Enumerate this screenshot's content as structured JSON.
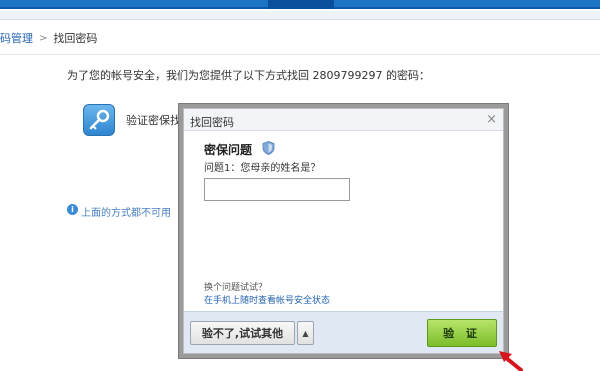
{
  "breadcrumb": {
    "parent": "码管理",
    "separator": ">",
    "current": "找回密码"
  },
  "intro_text": "为了您的帐号安全，我们为您提供了以下方式找回 2809799297 的密码：",
  "method": {
    "icon": "key-icon",
    "label": "验证密保找"
  },
  "unavailable": {
    "icon": "info-icon",
    "text": "上面的方式都不可用"
  },
  "dialog": {
    "title": "找回密码",
    "close": "×",
    "section_title": "密保问题",
    "shield_icon": "shield-icon",
    "question": "问题1：您母亲的姓名是？",
    "answer_value": "",
    "alt_question": "换个问题试试？",
    "phone_link": "在手机上随时查看帐号安全状态",
    "other_button": "验不了,试试其他",
    "other_caret": "▲",
    "verify_button": "验 证"
  },
  "colors": {
    "topbar": "#1c74c7",
    "link": "#2563b0",
    "verify_button": "#8cc83a",
    "cursor": "#d8141c"
  }
}
